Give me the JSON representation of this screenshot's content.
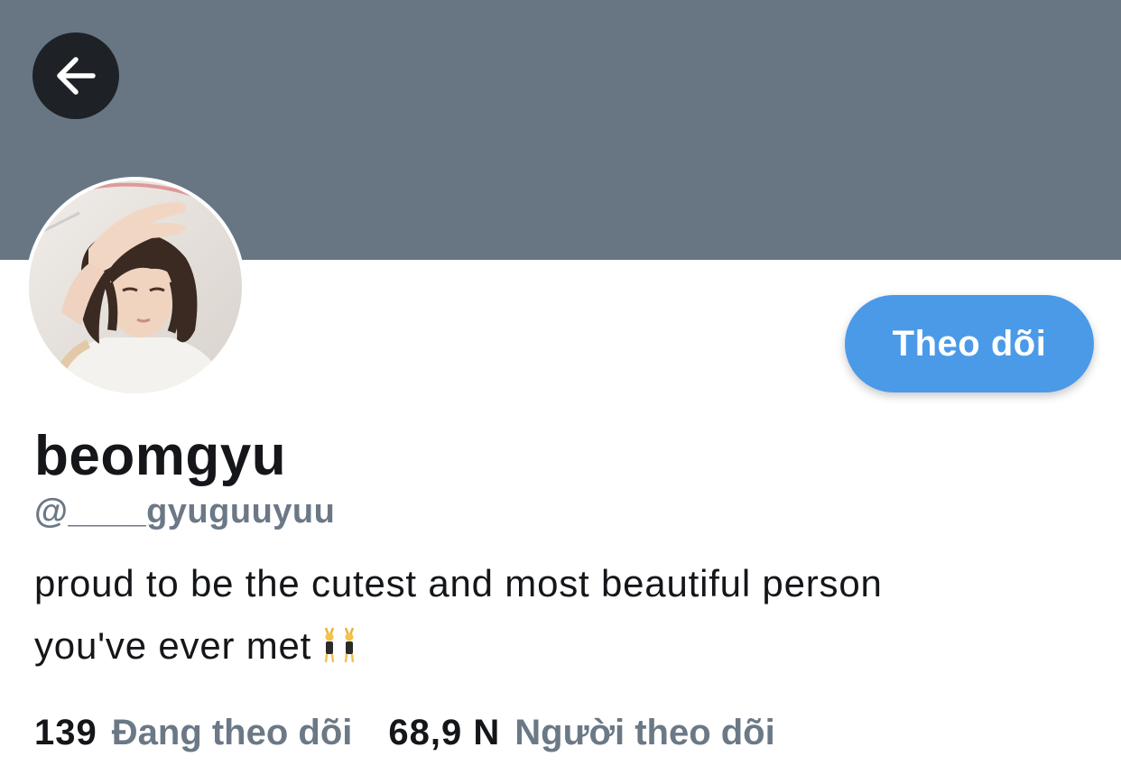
{
  "header": {
    "banner_color": "#687684",
    "back_icon": "arrow-left-icon"
  },
  "profile": {
    "display_name": "beomgyu",
    "handle": "@____gyuguuyuu",
    "bio_line1": "proud to be the cutest and most beautiful person",
    "bio_line2": "you've ever met",
    "bio_emoji": "women-with-bunny-ears-emoji",
    "follow_button_label": "Theo dõi"
  },
  "stats": {
    "following_count": "139",
    "following_label": "Đang theo dõi",
    "followers_count": "68,9 N",
    "followers_label": "Người theo dõi"
  },
  "colors": {
    "accent": "#4b9ae8",
    "muted_text": "#6b7886",
    "primary_text": "#141619"
  }
}
